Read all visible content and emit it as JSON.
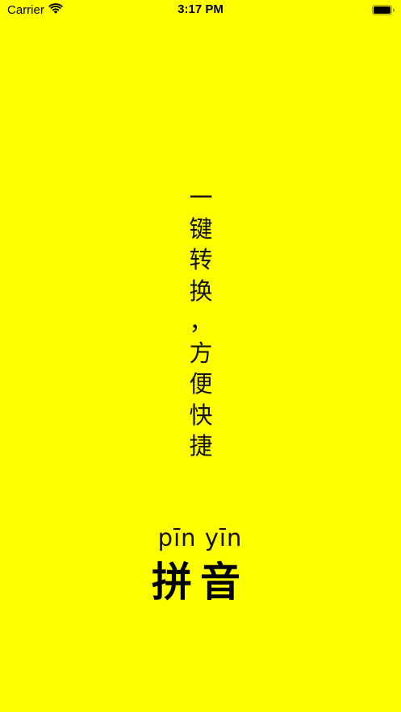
{
  "status_bar": {
    "carrier": "Carrier",
    "time": "3:17 PM",
    "icons": [
      "wifi-icon",
      "battery-icon"
    ]
  },
  "colors": {
    "background": "#FFFF00",
    "text": "#111111"
  },
  "slogan": {
    "chars": [
      "一",
      "键",
      "转",
      "换",
      "，",
      "方",
      "便",
      "快",
      "捷"
    ]
  },
  "logo": {
    "pinyin": "pīn yīn",
    "hanzi": "拼音"
  }
}
